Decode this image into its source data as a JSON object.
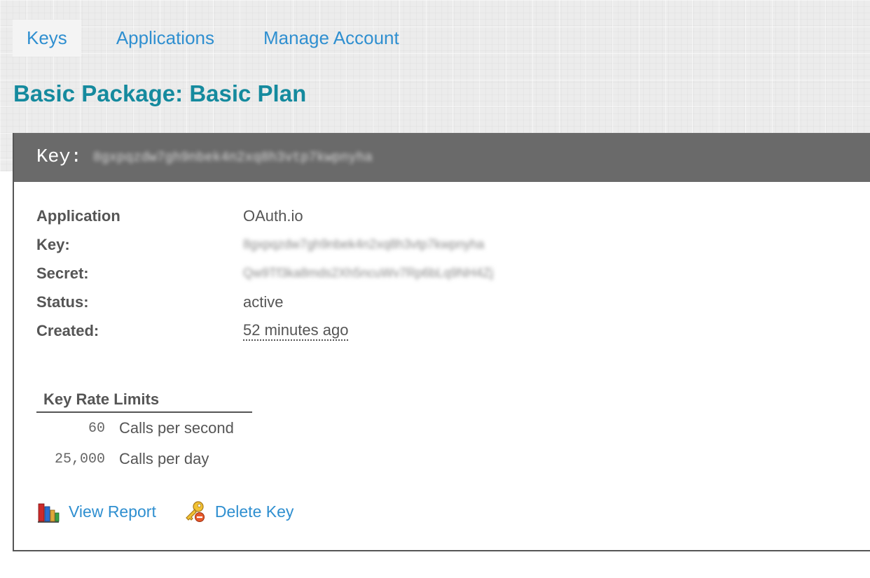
{
  "nav": {
    "tabs": [
      {
        "label": "Keys",
        "active": true
      },
      {
        "label": "Applications",
        "active": false
      },
      {
        "label": "Manage Account",
        "active": false
      }
    ]
  },
  "page": {
    "title": "Basic Package: Basic Plan"
  },
  "key_card": {
    "header_label": "Key:",
    "header_value": "8gxpqzdw7gh9nbek4n2xq8h3vtp7kwpnyha",
    "details": [
      {
        "label": "Application",
        "value": "OAuth.io"
      },
      {
        "label": "Key:",
        "value": "8gxpqzdw7gh9nbek4n2xq8h3vtp7kwpnyha"
      },
      {
        "label": "Secret:",
        "value": "Qw9Tf3ka8mds2Xh5ncuWv7Rp6bLq9NH4Zj"
      },
      {
        "label": "Status:",
        "value": "active"
      },
      {
        "label": "Created:",
        "value": "52 minutes ago"
      }
    ]
  },
  "rate_limits": {
    "title": "Key Rate Limits",
    "rows": [
      {
        "value": "60",
        "label": "Calls per second"
      },
      {
        "value": "25,000",
        "label": "Calls per day"
      }
    ]
  },
  "actions": {
    "view_report": {
      "label": "View Report",
      "icon": "bar-chart-icon"
    },
    "delete_key": {
      "label": "Delete Key",
      "icon": "key-delete-icon"
    }
  },
  "colors": {
    "link": "#2f8fd0",
    "title": "#158a9e",
    "header_bg": "#6a6a6a",
    "text": "#555555"
  }
}
